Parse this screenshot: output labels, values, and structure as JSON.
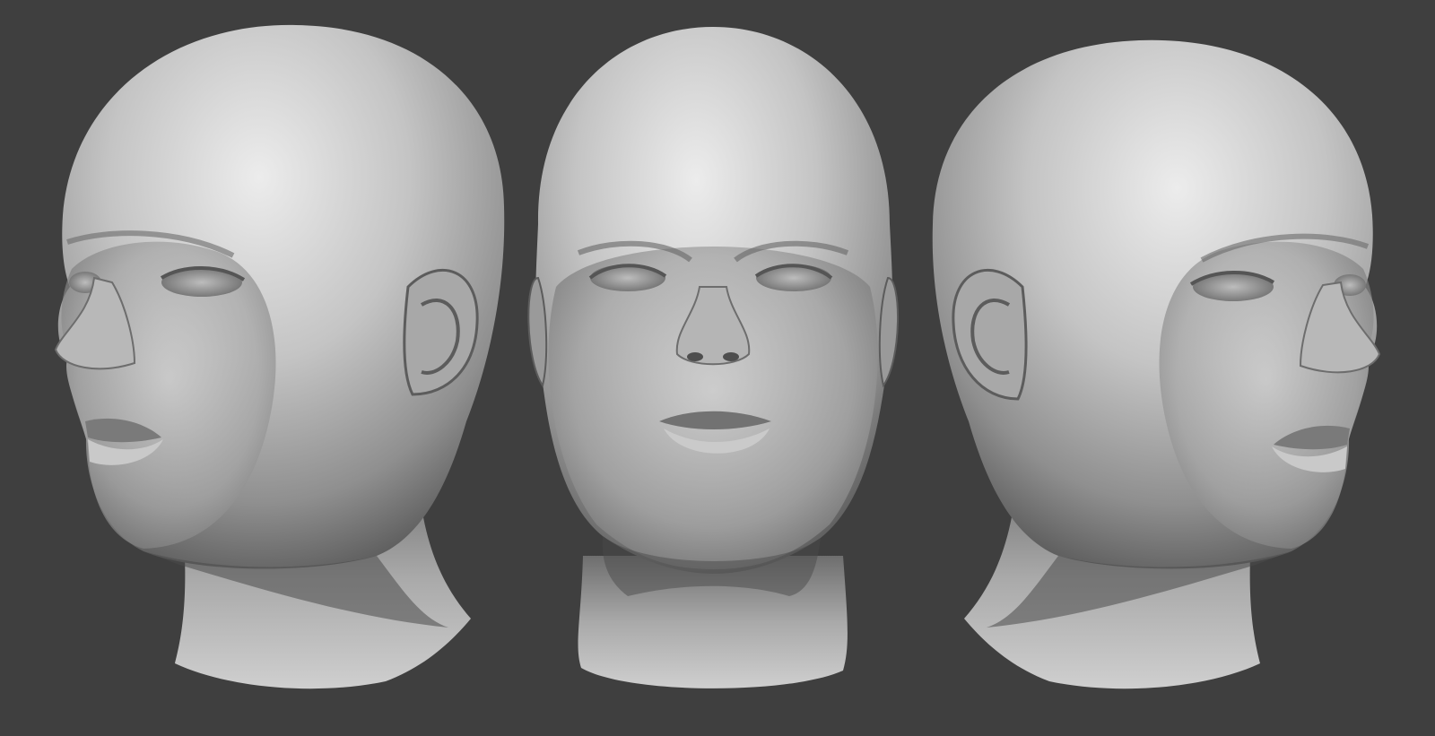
{
  "scene": {
    "background_color": "#3f3f3f",
    "material_color": "#b8b8b8",
    "highlight_color": "#e6e6e6",
    "shadow_color": "#4a4a4a",
    "views": [
      {
        "name": "three-quarter-left",
        "facing": "left"
      },
      {
        "name": "front",
        "facing": "front"
      },
      {
        "name": "three-quarter-right",
        "facing": "right"
      }
    ]
  }
}
